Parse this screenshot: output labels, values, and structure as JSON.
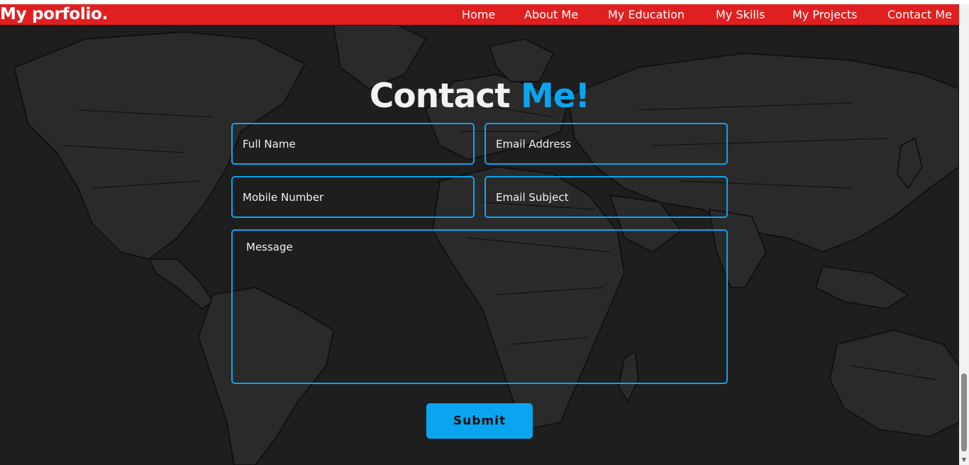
{
  "brand": "My porfolio.",
  "nav": [
    {
      "label": "Home"
    },
    {
      "label": "About Me"
    },
    {
      "label": "My Education"
    },
    {
      "label": "My Skills"
    },
    {
      "label": "My Projects"
    },
    {
      "label": "Contact Me"
    }
  ],
  "heading": {
    "part1": "Contact",
    "part2": "Me!"
  },
  "form": {
    "full_name_placeholder": "Full Name",
    "email_placeholder": "Email Address",
    "mobile_placeholder": "Mobile Number",
    "subject_placeholder": "Email Subject",
    "message_placeholder": "Message",
    "submit_label": "Submit"
  },
  "colors": {
    "navbar": "#e02020",
    "accent": "#0aa5f0",
    "background": "#1e1e1e"
  }
}
